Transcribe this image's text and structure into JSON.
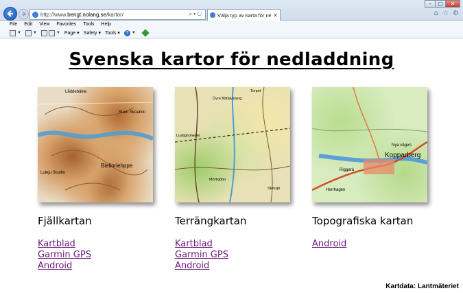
{
  "browser": {
    "address_url_prefix": "http://www.",
    "address_url_host": "bengt.nolang.se",
    "address_url_suffix": "/kartor/",
    "tab_title": "Välja typ av karta för nedlad...",
    "menu": [
      "File",
      "Edit",
      "View",
      "Favorites",
      "Tools",
      "Help"
    ],
    "commands": {
      "page": "Page",
      "safety": "Safety",
      "tools": "Tools"
    }
  },
  "page": {
    "title": "Svenska kartor för nedladdning",
    "credit": "Kartdata: Lantmäteriet"
  },
  "maps": [
    {
      "name": "Fjällkartan",
      "thumb_labels": [
        "Låddebäkte",
        "Stuor Skoarkki",
        "Bielloriehppe",
        "Luleju Stuollo"
      ],
      "links": [
        "Kartblad",
        "Garmin GPS",
        "Android"
      ]
    },
    {
      "name": "Terrängkartan",
      "thumb_labels": [
        "Övre Nittälvsberg",
        "Torpet",
        "Lustighoheder",
        "Mörtsjöbo",
        "Stensjö"
      ],
      "links": [
        "Kartblad",
        "Garmin GPS",
        "Android"
      ]
    },
    {
      "name": "Topografiska kartan",
      "thumb_labels": [
        "Kopparberg",
        "Riggarä",
        "Herrhagen",
        "Nya vägen"
      ],
      "links": [
        "Android"
      ]
    }
  ],
  "colors": {
    "link": "#6a1a78",
    "title": "#000000"
  }
}
